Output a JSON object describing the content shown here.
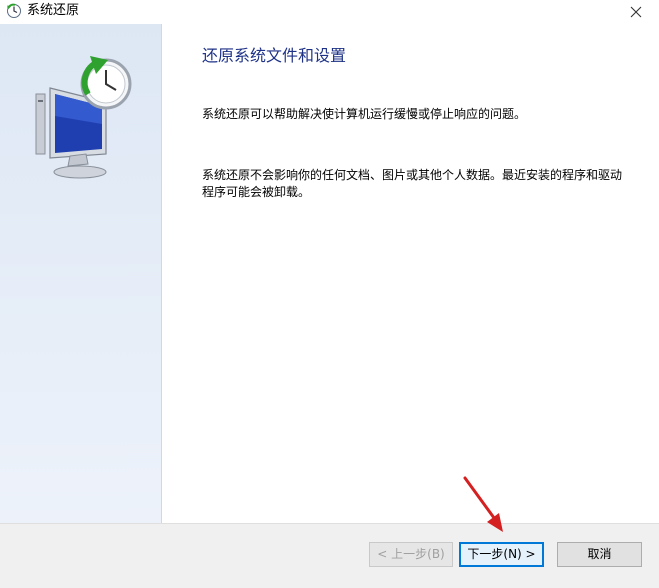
{
  "window": {
    "title": "系统还原",
    "close_glyph": "✕"
  },
  "content": {
    "heading": "还原系统文件和设置",
    "paragraph1": "系统还原可以帮助解决使计算机运行缓慢或停止响应的问题。",
    "paragraph2": "系统还原不会影响你的任何文档、图片或其他个人数据。最近安装的程序和驱动程序可能会被卸载。"
  },
  "footer": {
    "back_label": "< 上一步(B)",
    "next_label": "下一步(N) >",
    "cancel_label": "取消"
  },
  "colors": {
    "heading": "#1e3287",
    "sidebar": "#e3ebf6",
    "focus_border": "#0078d7",
    "annotation_arrow": "#d42020"
  },
  "icons": {
    "title": "system-restore-icon",
    "sidebar": "system-restore-monitor-clock-icon",
    "close": "close-icon",
    "annotation": "red-pointer-arrow"
  }
}
